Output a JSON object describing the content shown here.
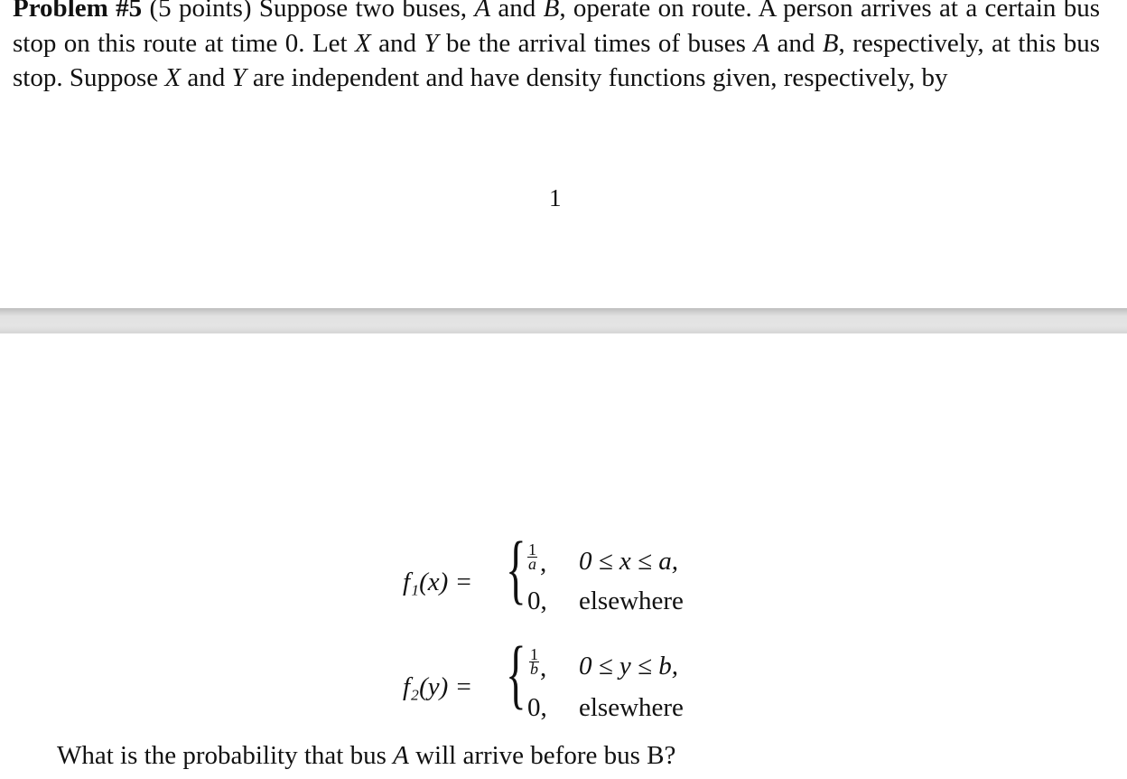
{
  "document": {
    "problem_label": "Problem #5",
    "points": "(5 points)",
    "intro_parts": {
      "t1": " Suppose two buses, ",
      "A": "A",
      "t2": " and ",
      "B": "B",
      "t3": ", operate on route. A person arrives at a certain bus stop on this route at time 0. Let ",
      "X": "X",
      "t4": " and ",
      "Y": "Y",
      "t5": " be the arrival times of buses ",
      "A2": "A",
      "t6": " and ",
      "B2": "B",
      "t7": ", respectively, at this bus stop. Suppose ",
      "X2": "X",
      "t8": " and ",
      "Y2": "Y",
      "t9": " are independent and have density functions given, respectively, by"
    },
    "page_number": "1",
    "equations": [
      {
        "lhs": "f₁(x) =",
        "case1_num": "1",
        "case1_den": "a",
        "case1_cond": "0 ≤ x ≤ a,",
        "case2_val": "0,",
        "case2_cond": "elsewhere"
      },
      {
        "lhs": "f₂(y) =",
        "case1_num": "1",
        "case1_den": "b",
        "case1_cond": "0 ≤ y ≤ b,",
        "case2_val": "0,",
        "case2_cond": "elsewhere"
      }
    ],
    "question_parts": {
      "q1": "What is the probability that bus ",
      "A": "A",
      "q2": " will arrive before bus B?"
    }
  }
}
